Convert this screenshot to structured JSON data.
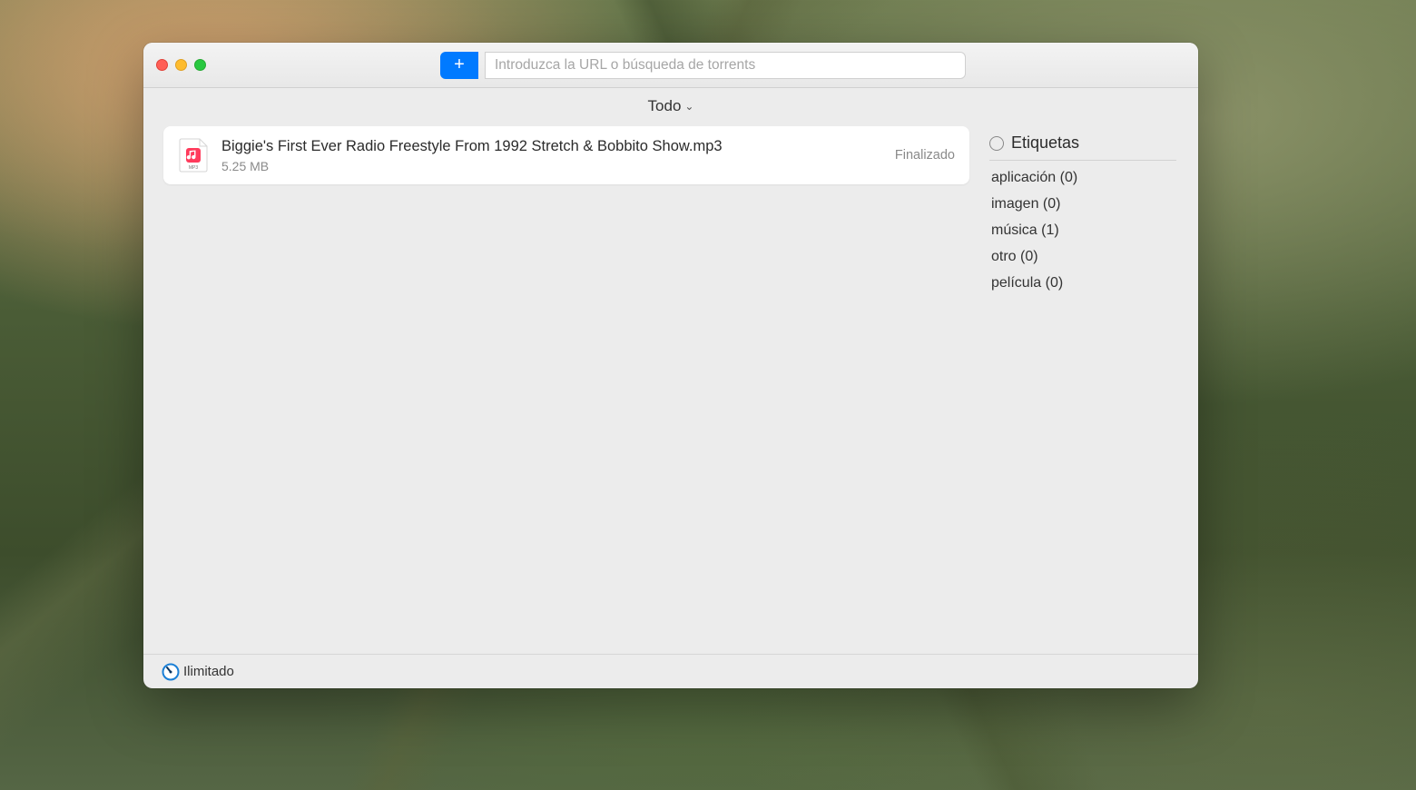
{
  "titlebar": {
    "search_placeholder": "Introduzca la URL o búsqueda de torrents",
    "add_glyph": "+"
  },
  "filter": {
    "label": "Todo"
  },
  "downloads": [
    {
      "title": "Biggie's First Ever Radio Freestyle From 1992 Stretch & Bobbito Show.mp3",
      "size": "5.25 MB",
      "status": "Finalizado",
      "icon": "mp3-file-icon"
    }
  ],
  "sidebar": {
    "title": "Etiquetas",
    "tags": [
      {
        "label": "aplicación",
        "count": 0
      },
      {
        "label": "imagen",
        "count": 0
      },
      {
        "label": "música",
        "count": 1
      },
      {
        "label": "otro",
        "count": 0
      },
      {
        "label": "película",
        "count": 0
      }
    ]
  },
  "statusbar": {
    "speed_label": "Ilimitado"
  }
}
